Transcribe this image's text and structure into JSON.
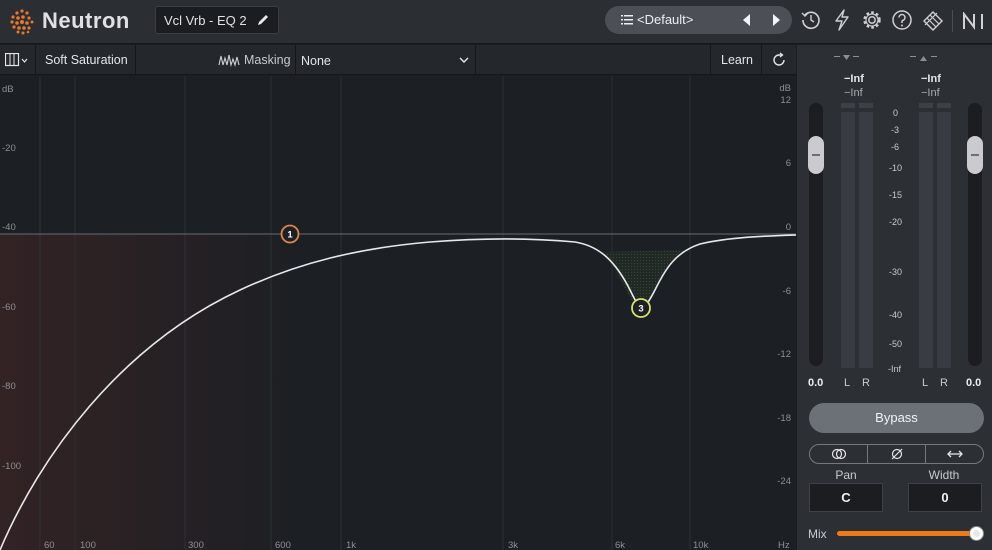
{
  "app": {
    "name": "Neutron",
    "track_name": "Vcl Vrb - EQ 2",
    "preset": "<Default>"
  },
  "toolbar": {
    "saturation_label": "Soft Saturation",
    "masking_label": "Masking",
    "masking_value": "None",
    "learn_label": "Learn"
  },
  "eq": {
    "db_label_left": "dB",
    "db_label_right": "dB",
    "left_axis_ticks": [
      "-20",
      "-40",
      "-60",
      "-80",
      "-100"
    ],
    "right_axis_ticks": [
      "12",
      "6",
      "0",
      "-6",
      "-12",
      "-18",
      "-24"
    ],
    "freq_ticks": [
      "60",
      "100",
      "300",
      "600",
      "1k",
      "3k",
      "6k",
      "10k",
      "Hz"
    ],
    "nodes": [
      {
        "label": "1",
        "color": "#e0864a"
      },
      {
        "label": "3",
        "color": "#d6e26a"
      }
    ]
  },
  "meters": {
    "input_peak": "−Inf",
    "input_rms": "−Inf",
    "output_peak": "−Inf",
    "output_rms": "−Inf",
    "scale": [
      "0",
      "-3",
      "-6",
      "-10",
      "-15",
      "-20",
      "-30",
      "-40",
      "-50",
      "-Inf"
    ],
    "input_gain": "0.0",
    "output_gain": "0.0",
    "left_label": "L",
    "right_label": "R"
  },
  "controls": {
    "bypass_label": "Bypass",
    "pan_label": "Pan",
    "pan_value": "C",
    "width_label": "Width",
    "width_value": "0",
    "mix_label": "Mix",
    "mix_level": 1.0,
    "accent_color": "#f07a1a"
  }
}
